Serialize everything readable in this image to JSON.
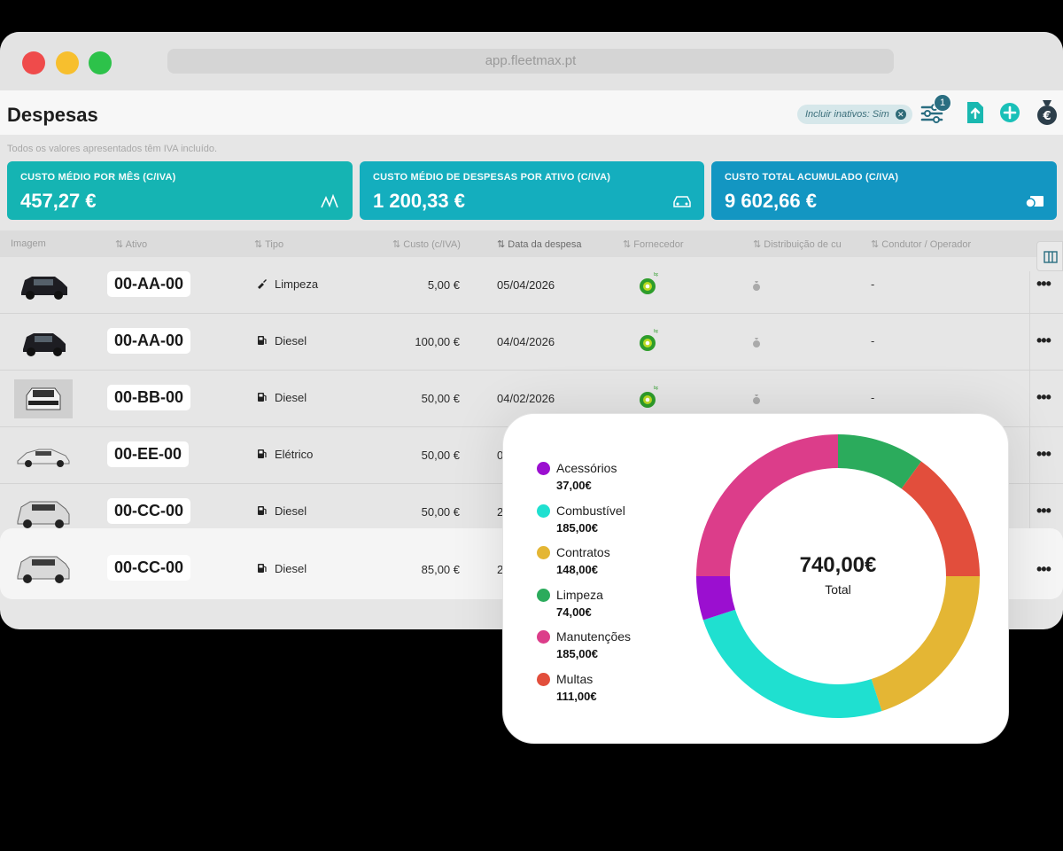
{
  "browser": {
    "url": "app.fleetmax.pt"
  },
  "header": {
    "title": "Despesas",
    "filter_chip": "Incluir inativos: Sim",
    "filter_badge": "1"
  },
  "note": "Todos os valores apresentados têm IVA incluído.",
  "cards": [
    {
      "label": "CUSTO MÉDIO POR MÊS (C/IVA)",
      "value": "457,27 €",
      "color": "#15b4b3",
      "icon": "chart-peaks-icon"
    },
    {
      "label": "CUSTO MÉDIO DE DESPESAS POR ATIVO (C/IVA)",
      "value": "1 200,33 €",
      "color": "#14aebe",
      "icon": "car-icon"
    },
    {
      "label": "CUSTO TOTAL ACUMULADO (C/IVA)",
      "value": "9 602,66 €",
      "color": "#1396c2",
      "icon": "money-stack-icon"
    }
  ],
  "table": {
    "columns": [
      "Imagem",
      "Ativo",
      "Tipo",
      "Custo (c/IVA)",
      "Data da despesa",
      "Fornecedor",
      "Distribuição de cu",
      "Condutor / Operador"
    ],
    "rows": [
      {
        "ativo": "00-AA-00",
        "tipo": "Limpeza",
        "tipo_icon": "cleaning-icon",
        "custo": "5,00 €",
        "data": "05/04/2026",
        "fornecedor_icon": "bp-logo",
        "condutor": "-"
      },
      {
        "ativo": "00-AA-00",
        "tipo": "Diesel",
        "tipo_icon": "fuel-pump-icon",
        "custo": "100,00 €",
        "data": "04/04/2026",
        "fornecedor_icon": "bp-logo",
        "condutor": "-"
      },
      {
        "ativo": "00-BB-00",
        "tipo": "Diesel",
        "tipo_icon": "fuel-pump-icon",
        "custo": "50,00 €",
        "data": "04/02/2026",
        "fornecedor_icon": "bp-logo",
        "condutor": "-"
      },
      {
        "ativo": "00-EE-00",
        "tipo": "Elétrico",
        "tipo_icon": "fuel-pump-icon",
        "custo": "50,00 €",
        "data": "0",
        "condutor": ""
      },
      {
        "ativo": "00-CC-00",
        "tipo": "Diesel",
        "tipo_icon": "fuel-pump-icon",
        "custo": "50,00 €",
        "data": "2",
        "condutor": ""
      },
      {
        "ativo": "00-CC-00",
        "tipo": "Diesel",
        "tipo_icon": "fuel-pump-icon",
        "custo": "85,00 €",
        "data": "2",
        "condutor": ""
      }
    ]
  },
  "chart_data": {
    "type": "pie",
    "categories": [
      "Acessórios",
      "Combustível",
      "Contratos",
      "Limpeza",
      "Manutenções",
      "Multas"
    ],
    "values": [
      37.0,
      185.0,
      148.0,
      74.0,
      185.0,
      111.0
    ],
    "value_labels": [
      "37,00€",
      "185,00€",
      "148,00€",
      "74,00€",
      "185,00€",
      "111,00€"
    ],
    "colors": [
      "#9b0fd0",
      "#1fe0d0",
      "#e4b634",
      "#2bab5c",
      "#dc3d8a",
      "#e24e3c"
    ],
    "total_label": "740,00€",
    "total_caption": "Total",
    "legend_position": "left"
  }
}
